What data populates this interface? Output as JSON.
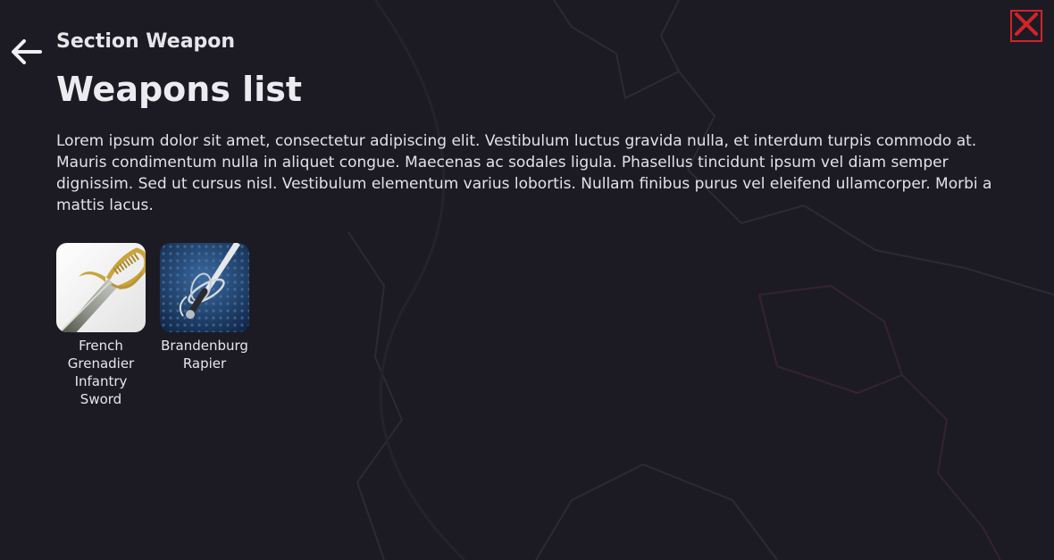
{
  "header": {
    "back_icon": "arrow-left-icon",
    "section_title": "Section Weapon",
    "close_icon": "close-x-icon",
    "close_color": "#d3232a"
  },
  "main": {
    "title": "Weapons list",
    "description": "Lorem ipsum dolor sit amet, consectetur adipiscing elit. Vestibulum luctus gravida nulla, et interdum turpis commodo at. Mauris condimentum nulla in aliquet congue. Maecenas ac sodales ligula. Phasellus tincidunt ipsum vel diam semper dignissim. Sed ut cursus nisl. Vestibulum elementum varius lobortis. Nullam finibus purus vel eleifend ullamcorper. Morbi a mattis lacus."
  },
  "weapons": [
    {
      "label": "French Grenadier Infantry Sword",
      "icon": "sabre-icon"
    },
    {
      "label": "Brandenburg Rapier",
      "icon": "rapier-icon"
    }
  ],
  "colors": {
    "background": "#1c1b24",
    "text": "#ececf0",
    "accent": "#d3232a"
  }
}
